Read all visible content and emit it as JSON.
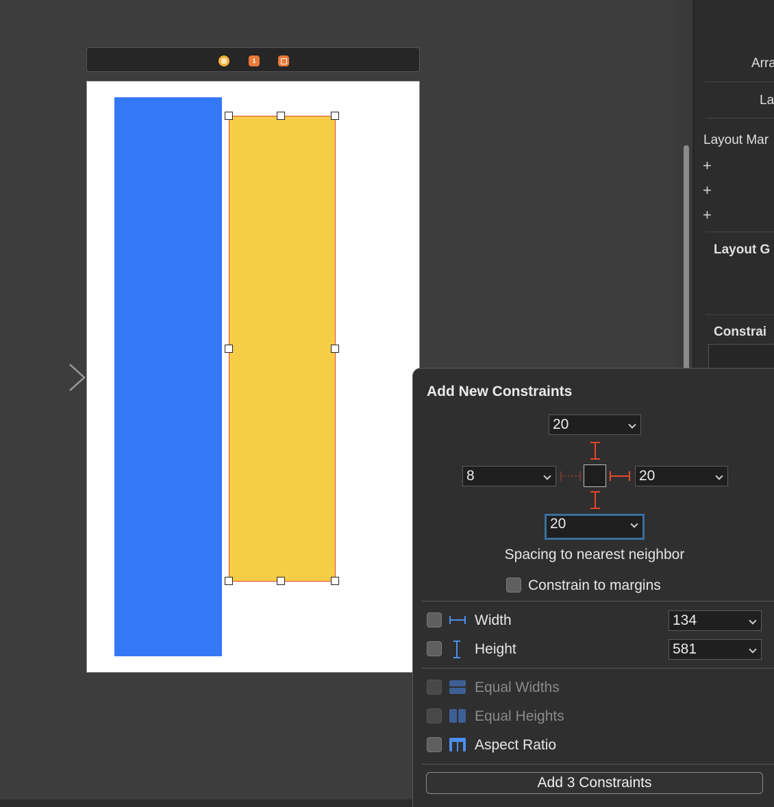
{
  "scene": {
    "dock_icons": [
      "view-controller-icon",
      "first-responder-icon",
      "exit-icon"
    ],
    "first_responder_glyph": "1"
  },
  "canvas": {
    "blue_view_color": "#3478f6",
    "yellow_view_color": "#f6cd47",
    "selection_color": "#e8452c"
  },
  "inspector": {
    "arrange_label": "Arra",
    "layout_label": "La",
    "layout_margins_label": "Layout Mar",
    "layout_guides_label": "Layout G",
    "constraints_label": "Constrai",
    "plus_glyph": "+"
  },
  "popover": {
    "title": "Add New Constraints",
    "top_value": "20",
    "leading_value": "8",
    "trailing_value": "20",
    "bottom_value": "20",
    "spacing_label": "Spacing to nearest neighbor",
    "constrain_margins_label": "Constrain to margins",
    "width_label": "Width",
    "width_value": "134",
    "height_label": "Height",
    "height_value": "581",
    "equal_widths_label": "Equal Widths",
    "equal_heights_label": "Equal Heights",
    "aspect_ratio_label": "Aspect Ratio",
    "add_button_label": "Add 3 Constraints",
    "accent_color": "#4b8ef0",
    "constraint_color": "#e8452c"
  }
}
